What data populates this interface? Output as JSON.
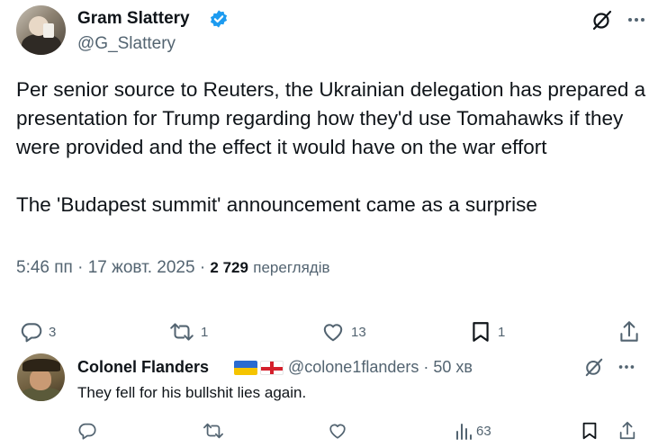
{
  "tweet": {
    "author_name": "Gram Slattery",
    "author_handle": "@G_Slattery",
    "text": "Per senior source to Reuters, the Ukrainian delegation has prepared a presentation for Trump regarding how they'd use Tomahawks if they were provided and the effect it would have on the war effort\n\nThe 'Budapest summit' announcement came as a surprise",
    "time": "5:46 пп",
    "date": "17 жовт. 2025",
    "views_count": "2 729",
    "views_label": "переглядів",
    "sep": "·",
    "stats": {
      "replies": "3",
      "reposts": "1",
      "likes": "13",
      "bookmarks": "1"
    }
  },
  "reply": {
    "author_name": "Colonel Flanders",
    "author_handle": "@colone1flanders",
    "sep": "·",
    "time": "50 хв",
    "text": "They fell for his bullshit lies again.",
    "stats": {
      "views": "63"
    }
  },
  "colors": {
    "verified": "#1d9bf0",
    "text_primary": "#0f1419",
    "text_secondary": "#536471"
  },
  "icons": {
    "verified": "verified-badge-icon",
    "grok": "grok-icon",
    "more": "more-icon",
    "reply": "reply-icon",
    "repost": "repost-icon",
    "like": "like-icon",
    "bookmark": "bookmark-icon",
    "share": "share-icon",
    "views": "views-icon"
  }
}
